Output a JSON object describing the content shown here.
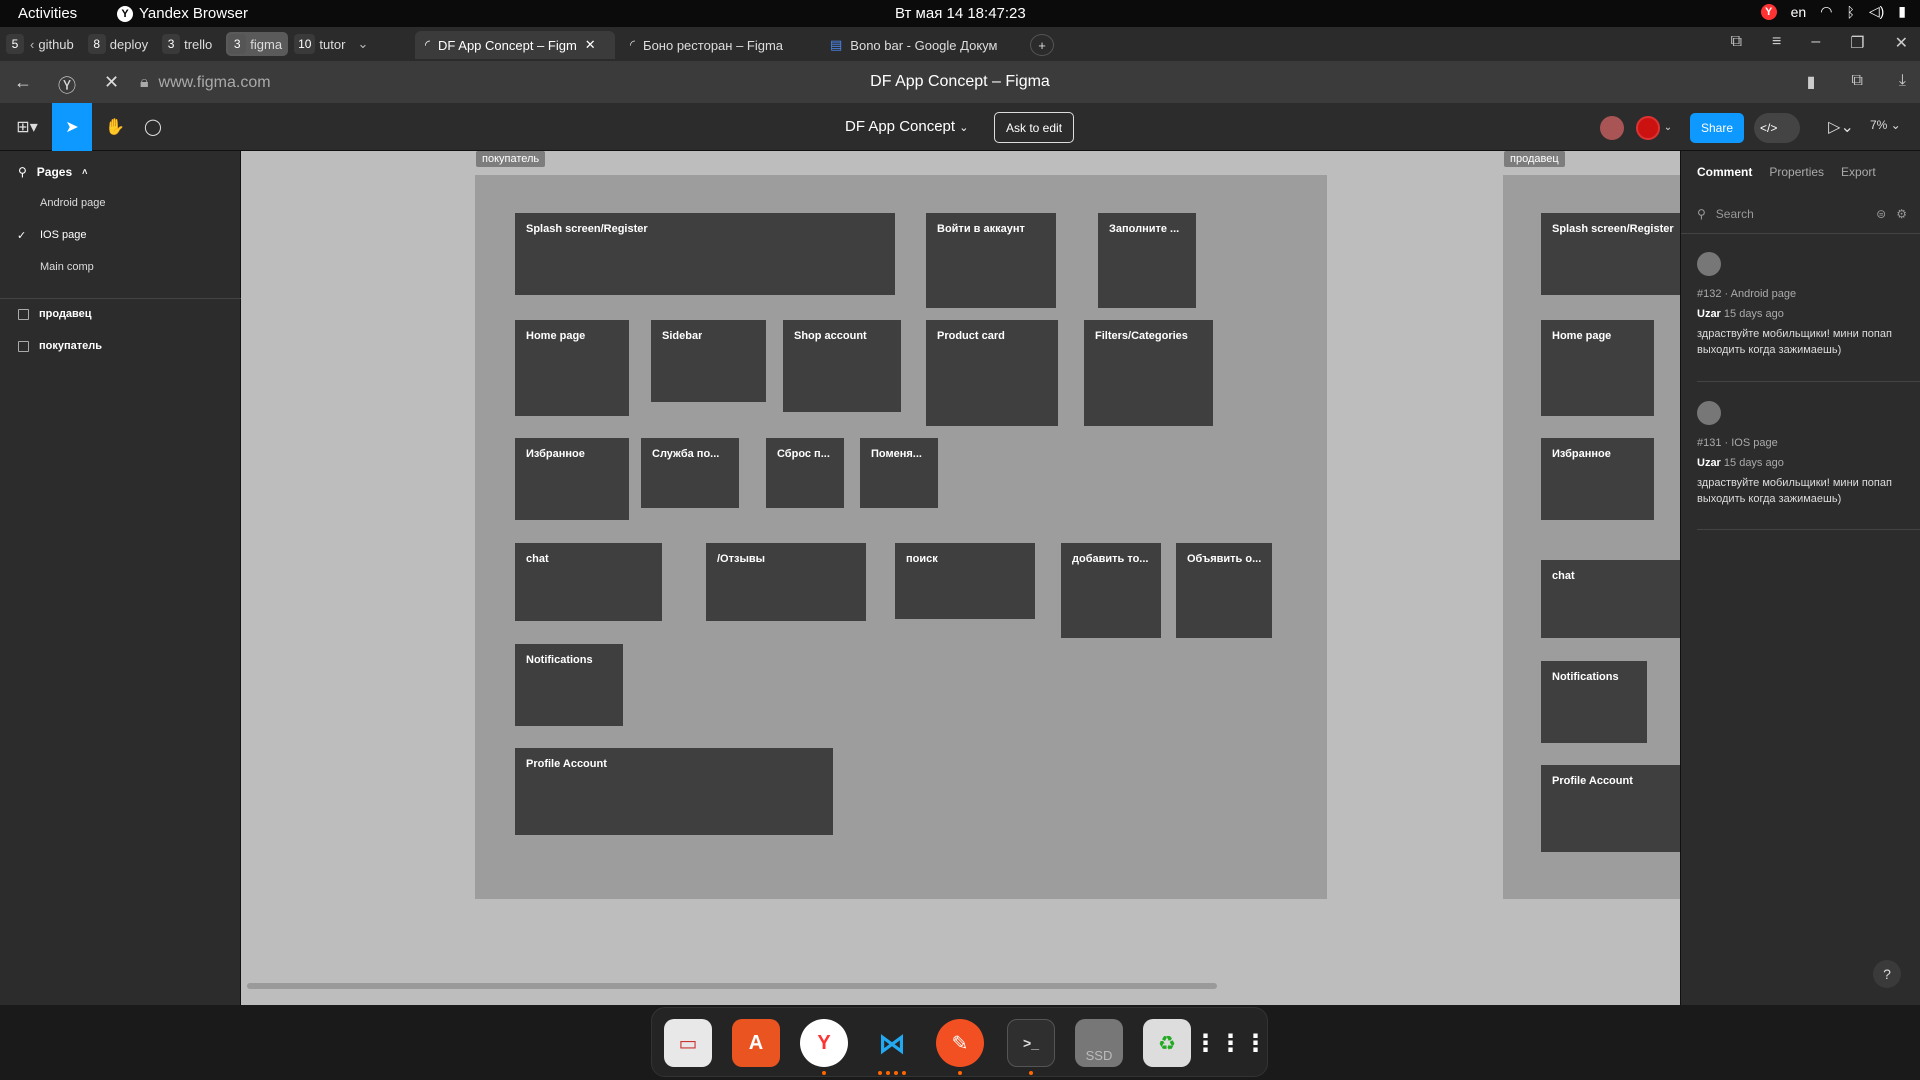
{
  "system": {
    "activities": "Activities",
    "app_name": "Yandex Browser",
    "clock": "Вт мая 14  18:47:23",
    "lang": "en"
  },
  "tab_groups": [
    {
      "num": "5",
      "label": ""
    },
    {
      "num": "",
      "label": "github"
    },
    {
      "num": "8",
      "label": "deploy"
    },
    {
      "num": "3",
      "label": "trello"
    },
    {
      "num": "3",
      "label": "figma"
    },
    {
      "num": "10",
      "label": "tutor"
    }
  ],
  "tabs": [
    {
      "label": "DF App Concept – Figm"
    },
    {
      "label": "Боно ресторан – Figma"
    },
    {
      "label": "Bono bar - Google Докум"
    }
  ],
  "urlbar": {
    "url": "www.figma.com",
    "title": "DF App Concept – Figma"
  },
  "figma": {
    "file_name": "DF App Concept",
    "ask_to_edit": "Ask to edit",
    "share": "Share",
    "zoom": "7%"
  },
  "left_panel": {
    "pages_header": "Pages",
    "pages": [
      "Android page",
      "IOS page",
      "Main comp"
    ],
    "active_page": "IOS page",
    "layers": [
      "продавец",
      "покупатель"
    ]
  },
  "canvas": {
    "section_buyer": "покупатель",
    "section_seller": "продавец",
    "buyer_frames": [
      "Splash screen/Register",
      "Войти в аккаунт",
      "Заполните ...",
      "Home page",
      "Sidebar",
      "Shop account",
      "Product card",
      "Filters/Categories",
      "Избранное",
      "Служба по...",
      "Сброс п...",
      "Поменя...",
      "chat",
      "/Отзывы",
      "поиск",
      "добавить то...",
      "Объявить о...",
      "Notifications",
      "Profile Account"
    ],
    "seller_frames": [
      "Splash screen/Register",
      "Home page",
      "Избранное",
      "chat",
      "Notifications",
      "Profile Account"
    ]
  },
  "right_panel": {
    "tabs": [
      "Comment",
      "Properties",
      "Export"
    ],
    "search_placeholder": "Search",
    "comments": [
      {
        "ref": "#132 · Android page",
        "user": "Uzar",
        "time": "15 days ago",
        "text": "здраствуйте мобильщики! мини попап выходить когда зажимаешь)"
      },
      {
        "ref": "#131 · IOS page",
        "user": "Uzar",
        "time": "15 days ago",
        "text": "здраствуйте мобильщики! мини попап выходить когда зажимаешь)"
      }
    ],
    "help": "?"
  },
  "dock": {
    "ssd_label": "SSD"
  }
}
